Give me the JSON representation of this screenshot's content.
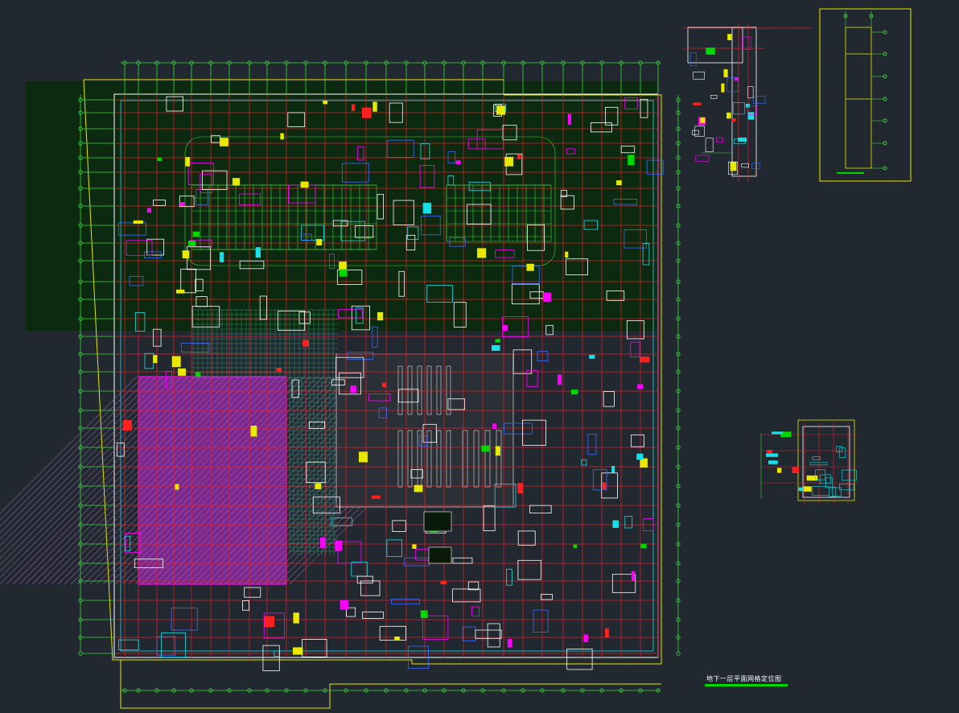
{
  "drawing": {
    "background": "#212830",
    "site_fill": "#0b2a0f",
    "grid_color": "#e0202a",
    "axis_color": "#3cd73c",
    "wall_color": "#ffffff",
    "boundary_color": "#e8e800",
    "accent_cyan": "#18e0e8",
    "accent_magenta": "#ff00ff",
    "accent_blue": "#3a6cff",
    "hatch_purple": "#8a2a9a",
    "caption": "地下一层平面网格定位图",
    "caption_underline_color": "#00d800"
  },
  "panels": [
    {
      "id": "main-plan",
      "kind": "floor-plan"
    },
    {
      "id": "detail-corner",
      "kind": "enlarged-detail"
    },
    {
      "id": "detail-strip",
      "kind": "elevation-strip"
    },
    {
      "id": "detail-small",
      "kind": "enlarged-detail"
    }
  ]
}
